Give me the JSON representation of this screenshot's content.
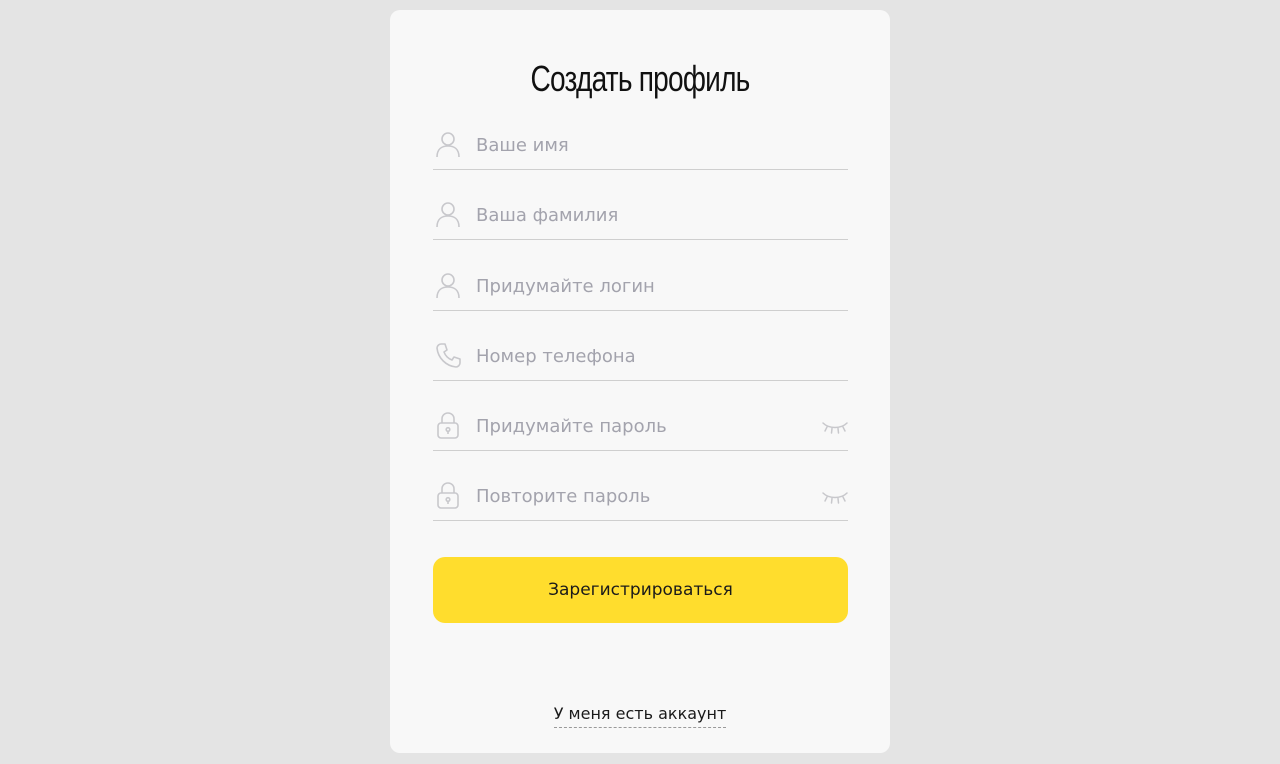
{
  "form": {
    "title": "Создать профиль",
    "fields": [
      {
        "id": "first-name",
        "icon": "user-icon",
        "placeholder": "Ваше имя",
        "value": ""
      },
      {
        "id": "last-name",
        "icon": "user-icon",
        "placeholder": "Ваша фамилия",
        "value": ""
      },
      {
        "id": "login",
        "icon": "user-icon",
        "placeholder": "Придумайте логин",
        "value": ""
      },
      {
        "id": "phone",
        "icon": "phone-icon",
        "placeholder": "Номер телефона",
        "value": ""
      },
      {
        "id": "password",
        "icon": "lock-icon",
        "placeholder": "Придумайте пароль",
        "value": "",
        "toggle_icon": "eye-closed-icon"
      },
      {
        "id": "password-repeat",
        "icon": "lock-icon",
        "placeholder": "Повторите пароль",
        "value": "",
        "toggle_icon": "eye-closed-icon"
      }
    ],
    "submit_label": "Зарегистрироваться",
    "login_link_label": "У меня есть аккаунт"
  },
  "colors": {
    "background": "#e4e4e4",
    "card": "#f8f8f8",
    "accent": "#ffdd2d",
    "placeholder": "#a3a3ad",
    "icon": "#c8c8cc"
  }
}
